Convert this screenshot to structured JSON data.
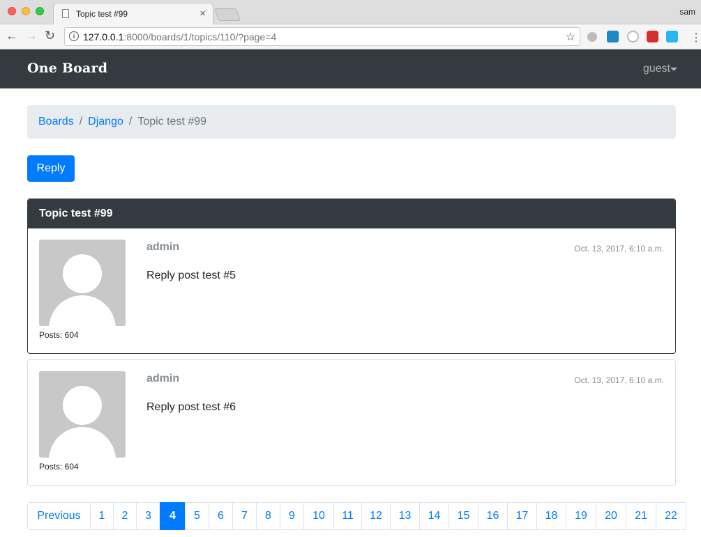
{
  "browser": {
    "tab_title": "Topic test #99",
    "profile_name": "sam",
    "url_host": "127.0.0.1",
    "url_rest": ":8000/boards/1/topics/110/?page=4"
  },
  "navbar": {
    "brand": "One Board",
    "user_menu": "guest"
  },
  "breadcrumb": {
    "items": [
      "Boards",
      "Django"
    ],
    "separator": "/",
    "active": "Topic test #99"
  },
  "reply_button": "Reply",
  "topic": {
    "title": "Topic test #99",
    "posts": [
      {
        "author": "admin",
        "date": "Oct. 13, 2017, 6:10 a.m.",
        "message": "Reply post test #5",
        "post_count": "Posts: 604"
      },
      {
        "author": "admin",
        "date": "Oct. 13, 2017, 6:10 a.m.",
        "message": "Reply post test #6",
        "post_count": "Posts: 604"
      }
    ]
  },
  "pagination": {
    "previous": "Previous",
    "pages": [
      "1",
      "2",
      "3",
      "4",
      "5",
      "6",
      "7",
      "8",
      "9",
      "10",
      "11",
      "12",
      "13",
      "14",
      "15",
      "16",
      "17",
      "18",
      "19",
      "20",
      "21",
      "22"
    ],
    "active_page": "4"
  },
  "colors": {
    "primary": "#007bff",
    "dark": "#343a40",
    "muted": "#868e96"
  }
}
